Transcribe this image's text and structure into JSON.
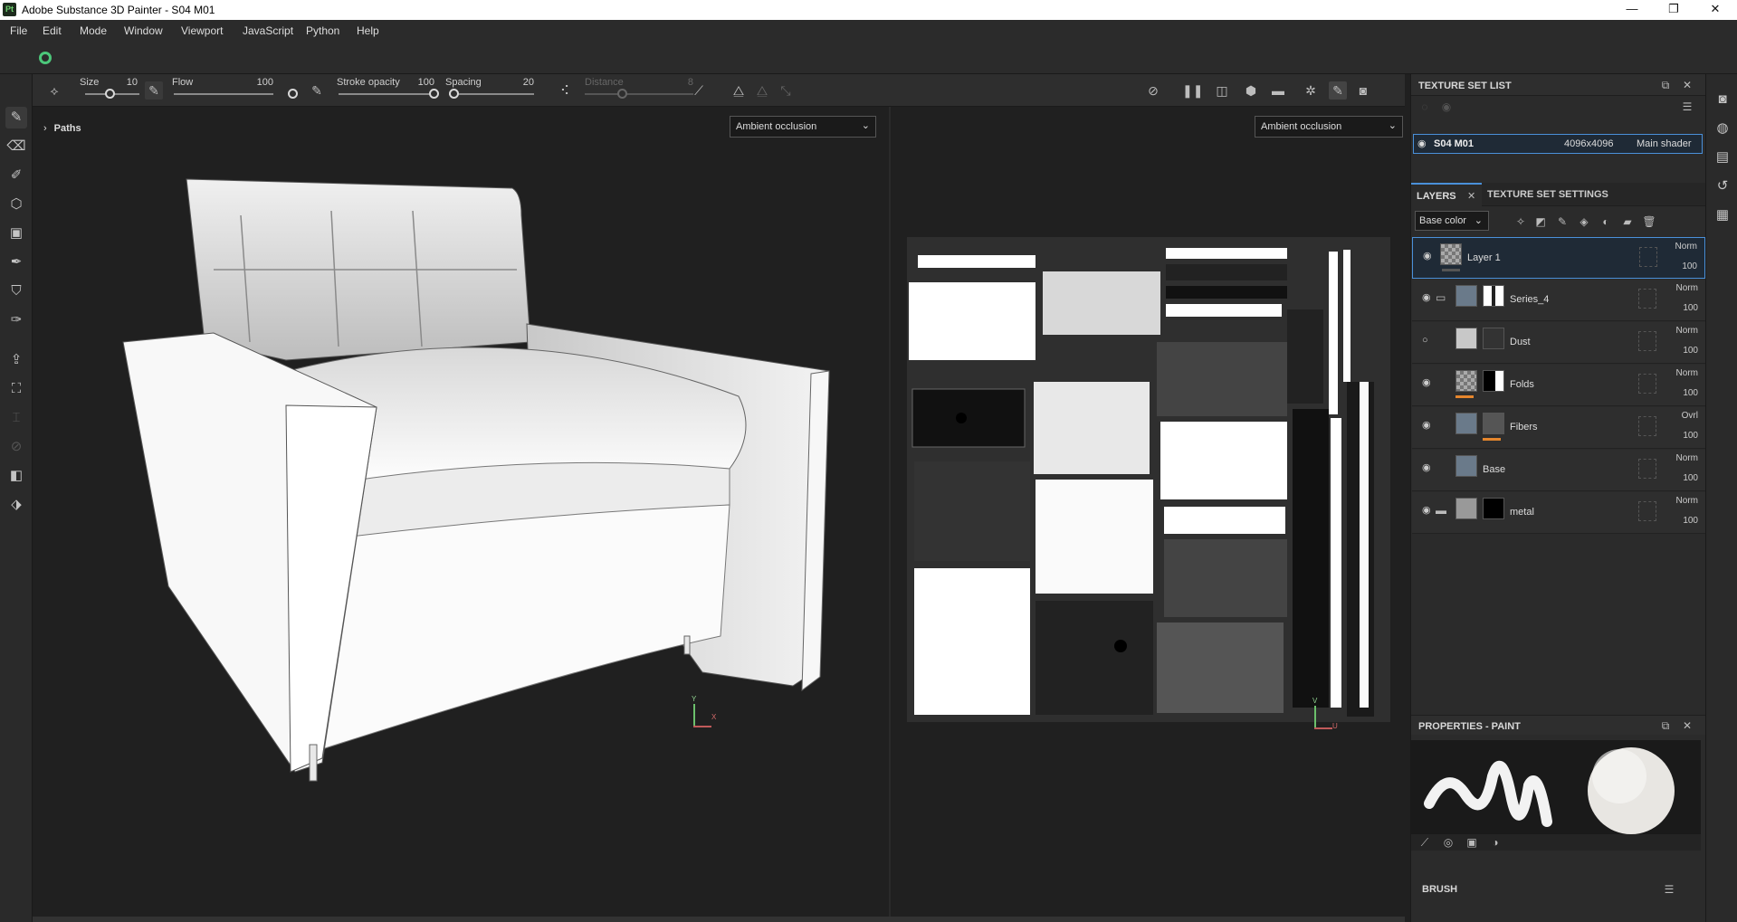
{
  "app": {
    "title": "Adobe Substance 3D Painter - S04 M01",
    "icon_text": "Pt"
  },
  "window_controls": {
    "minimize": "—",
    "maximize": "❐",
    "close": "✕"
  },
  "menu": [
    "File",
    "Edit",
    "Mode",
    "Window",
    "Viewport",
    "JavaScript",
    "Python",
    "Help"
  ],
  "toolbar": {
    "size_label": "Size",
    "size_value": "10",
    "flow_label": "Flow",
    "flow_value": "100",
    "stroke_opacity_label": "Stroke opacity",
    "stroke_opacity_value": "100",
    "spacing_label": "Spacing",
    "spacing_value": "20",
    "distance_label": "Distance",
    "distance_value": "8"
  },
  "viewport3d": {
    "paths_label": "Paths",
    "channel": "Ambient occlusion",
    "axes": {
      "y": "Y",
      "x": "X"
    }
  },
  "viewport2d": {
    "channel": "Ambient occlusion",
    "axes": {
      "v": "V",
      "u": "U"
    }
  },
  "texture_set_list": {
    "title": "TEXTURE SET LIST",
    "item": {
      "name": "S04 M01",
      "resolution": "4096x4096",
      "shader": "Main shader"
    }
  },
  "layers_panel": {
    "tab_layers": "LAYERS",
    "tab_settings": "TEXTURE SET SETTINGS",
    "channel": "Base color",
    "layers": [
      {
        "name": "Layer 1",
        "blend": "Norm",
        "opacity": "100"
      },
      {
        "name": "Series_4",
        "blend": "Norm",
        "opacity": "100"
      },
      {
        "name": "Dust",
        "blend": "Norm",
        "opacity": "100"
      },
      {
        "name": "Folds",
        "blend": "Norm",
        "opacity": "100"
      },
      {
        "name": "Fibers",
        "blend": "Ovrl",
        "opacity": "100"
      },
      {
        "name": "Base",
        "blend": "Norm",
        "opacity": "100"
      },
      {
        "name": "metal",
        "blend": "Norm",
        "opacity": "100"
      }
    ]
  },
  "properties": {
    "title": "PROPERTIES - PAINT",
    "brush_label": "BRUSH"
  },
  "colors": {
    "accent": "#4a90d9",
    "orange": "#e5862d",
    "panel": "#2b2b2b",
    "bg": "#202020"
  }
}
